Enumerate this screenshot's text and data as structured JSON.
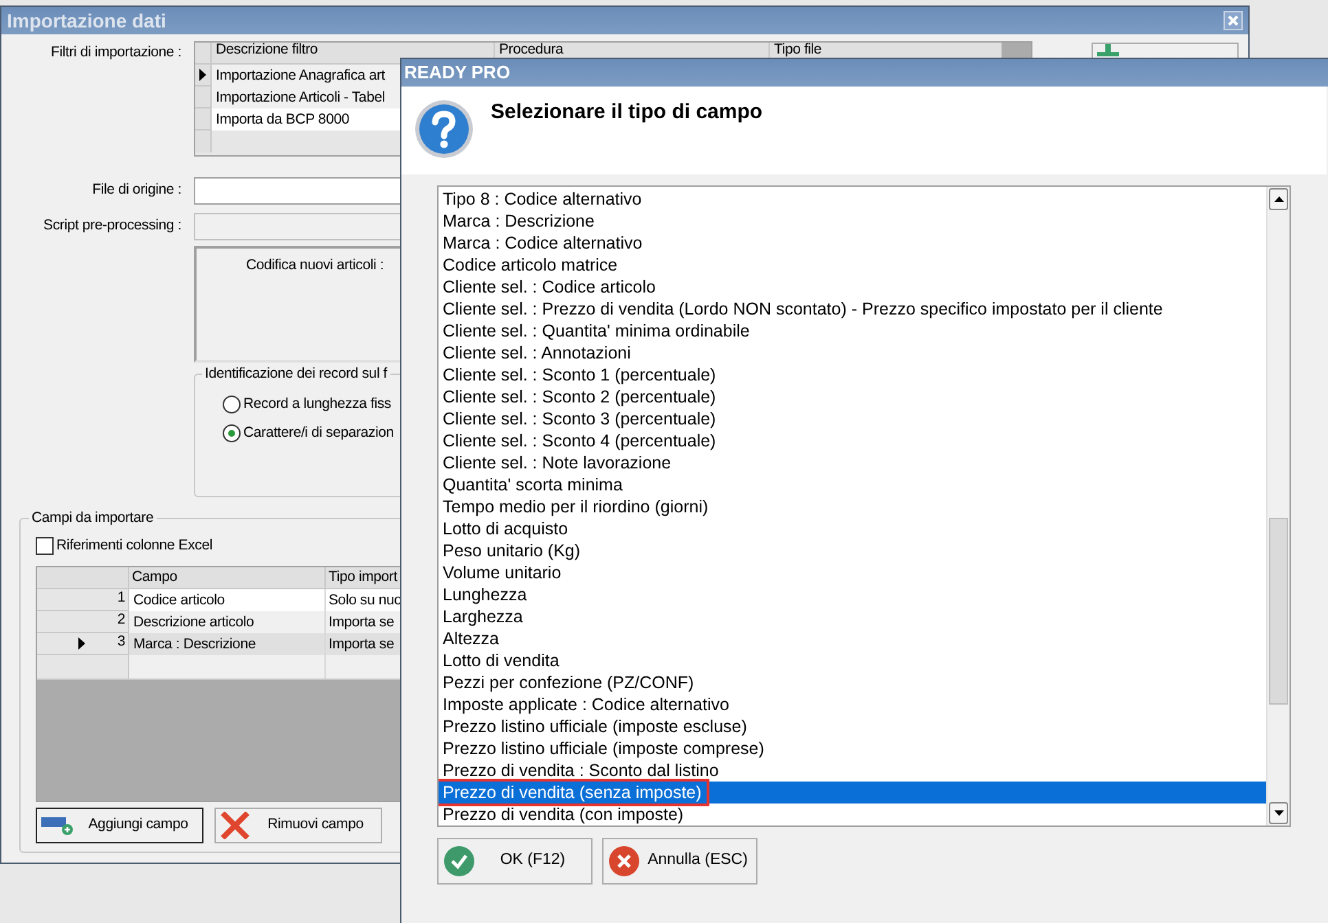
{
  "main_window": {
    "title": "Importazione dati",
    "filters": {
      "label": "Filtri di importazione :",
      "columns": [
        "Descrizione filtro",
        "Procedura",
        "Tipo file"
      ],
      "rows": [
        {
          "description": "Importazione Anagrafica art",
          "selected": true
        },
        {
          "description": "Importazione Articoli - Tabel",
          "selected": false
        },
        {
          "description": "Importa da BCP 8000",
          "selected": false
        }
      ]
    },
    "source_file": {
      "label": "File di origine :"
    },
    "preprocessing_script": {
      "label": "Script pre-processing :"
    },
    "new_item_coding": {
      "label": "Codifica nuovi articoli :"
    },
    "record_identification": {
      "title": "Identificazione dei record sul f",
      "options": [
        {
          "label": "Record a lunghezza fiss",
          "selected": false
        },
        {
          "label": "Carattere/i di separazion",
          "selected": true
        }
      ]
    },
    "fields_group": {
      "title": "Campi da importare",
      "excel_refs": {
        "label": "Riferimenti colonne Excel",
        "checked": false
      },
      "columns": [
        "Campo",
        "Tipo import"
      ],
      "rows": [
        {
          "number": "1",
          "field": "Codice articolo",
          "import_type": "Solo su nuo",
          "selected": false
        },
        {
          "number": "2",
          "field": "Descrizione articolo",
          "import_type": "Importa se",
          "selected": false
        },
        {
          "number": "3",
          "field": "Marca : Descrizione",
          "import_type": "Importa se",
          "selected": true
        }
      ],
      "buttons": [
        {
          "label": "Aggiungi campo",
          "kind": "add"
        },
        {
          "label": "Rimuovi campo",
          "kind": "remove"
        }
      ]
    }
  },
  "dialog": {
    "title": "READY PRO",
    "prompt": "Selezionare il tipo di campo",
    "items": [
      {
        "label": "Tipo 8 : Codice alternativo",
        "selected": false,
        "outlined": false
      },
      {
        "label": "Marca : Descrizione",
        "selected": false,
        "outlined": false
      },
      {
        "label": "Marca : Codice alternativo",
        "selected": false,
        "outlined": false
      },
      {
        "label": "Codice articolo matrice",
        "selected": false,
        "outlined": false
      },
      {
        "label": "Cliente sel. : Codice articolo",
        "selected": false,
        "outlined": false
      },
      {
        "label": "Cliente sel. : Prezzo di vendita (Lordo NON scontato) - Prezzo specifico impostato per il cliente",
        "selected": false,
        "outlined": false
      },
      {
        "label": "Cliente sel. : Quantita' minima ordinabile",
        "selected": false,
        "outlined": false
      },
      {
        "label": "Cliente sel. : Annotazioni",
        "selected": false,
        "outlined": false
      },
      {
        "label": "Cliente sel. : Sconto 1 (percentuale)",
        "selected": false,
        "outlined": false
      },
      {
        "label": "Cliente sel. : Sconto 2 (percentuale)",
        "selected": false,
        "outlined": false
      },
      {
        "label": "Cliente sel. : Sconto 3 (percentuale)",
        "selected": false,
        "outlined": false
      },
      {
        "label": "Cliente sel. : Sconto 4 (percentuale)",
        "selected": false,
        "outlined": false
      },
      {
        "label": "Cliente sel. : Note lavorazione",
        "selected": false,
        "outlined": false
      },
      {
        "label": "Quantita' scorta minima",
        "selected": false,
        "outlined": false
      },
      {
        "label": "Tempo medio per il riordino (giorni)",
        "selected": false,
        "outlined": false
      },
      {
        "label": "Lotto di acquisto",
        "selected": false,
        "outlined": false
      },
      {
        "label": "Peso unitario (Kg)",
        "selected": false,
        "outlined": false
      },
      {
        "label": "Volume unitario",
        "selected": false,
        "outlined": false
      },
      {
        "label": "Lunghezza",
        "selected": false,
        "outlined": false
      },
      {
        "label": "Larghezza",
        "selected": false,
        "outlined": false
      },
      {
        "label": "Altezza",
        "selected": false,
        "outlined": false
      },
      {
        "label": "Lotto di vendita",
        "selected": false,
        "outlined": false
      },
      {
        "label": "Pezzi per confezione (PZ/CONF)",
        "selected": false,
        "outlined": false
      },
      {
        "label": "Imposte applicate : Codice alternativo",
        "selected": false,
        "outlined": false
      },
      {
        "label": "Prezzo listino ufficiale (imposte escluse)",
        "selected": false,
        "outlined": false
      },
      {
        "label": "Prezzo listino ufficiale (imposte comprese)",
        "selected": false,
        "outlined": false
      },
      {
        "label": "Prezzo di vendita : Sconto dal listino",
        "selected": false,
        "outlined": false
      },
      {
        "label": "Prezzo di vendita (senza imposte)",
        "selected": true,
        "outlined": true
      },
      {
        "label": "Prezzo di vendita (con imposte)",
        "selected": false,
        "outlined": false
      }
    ],
    "buttons": [
      {
        "label": "OK (F12)",
        "kind": "ok"
      },
      {
        "label": "Annulla (ESC)",
        "kind": "cancel"
      }
    ]
  }
}
